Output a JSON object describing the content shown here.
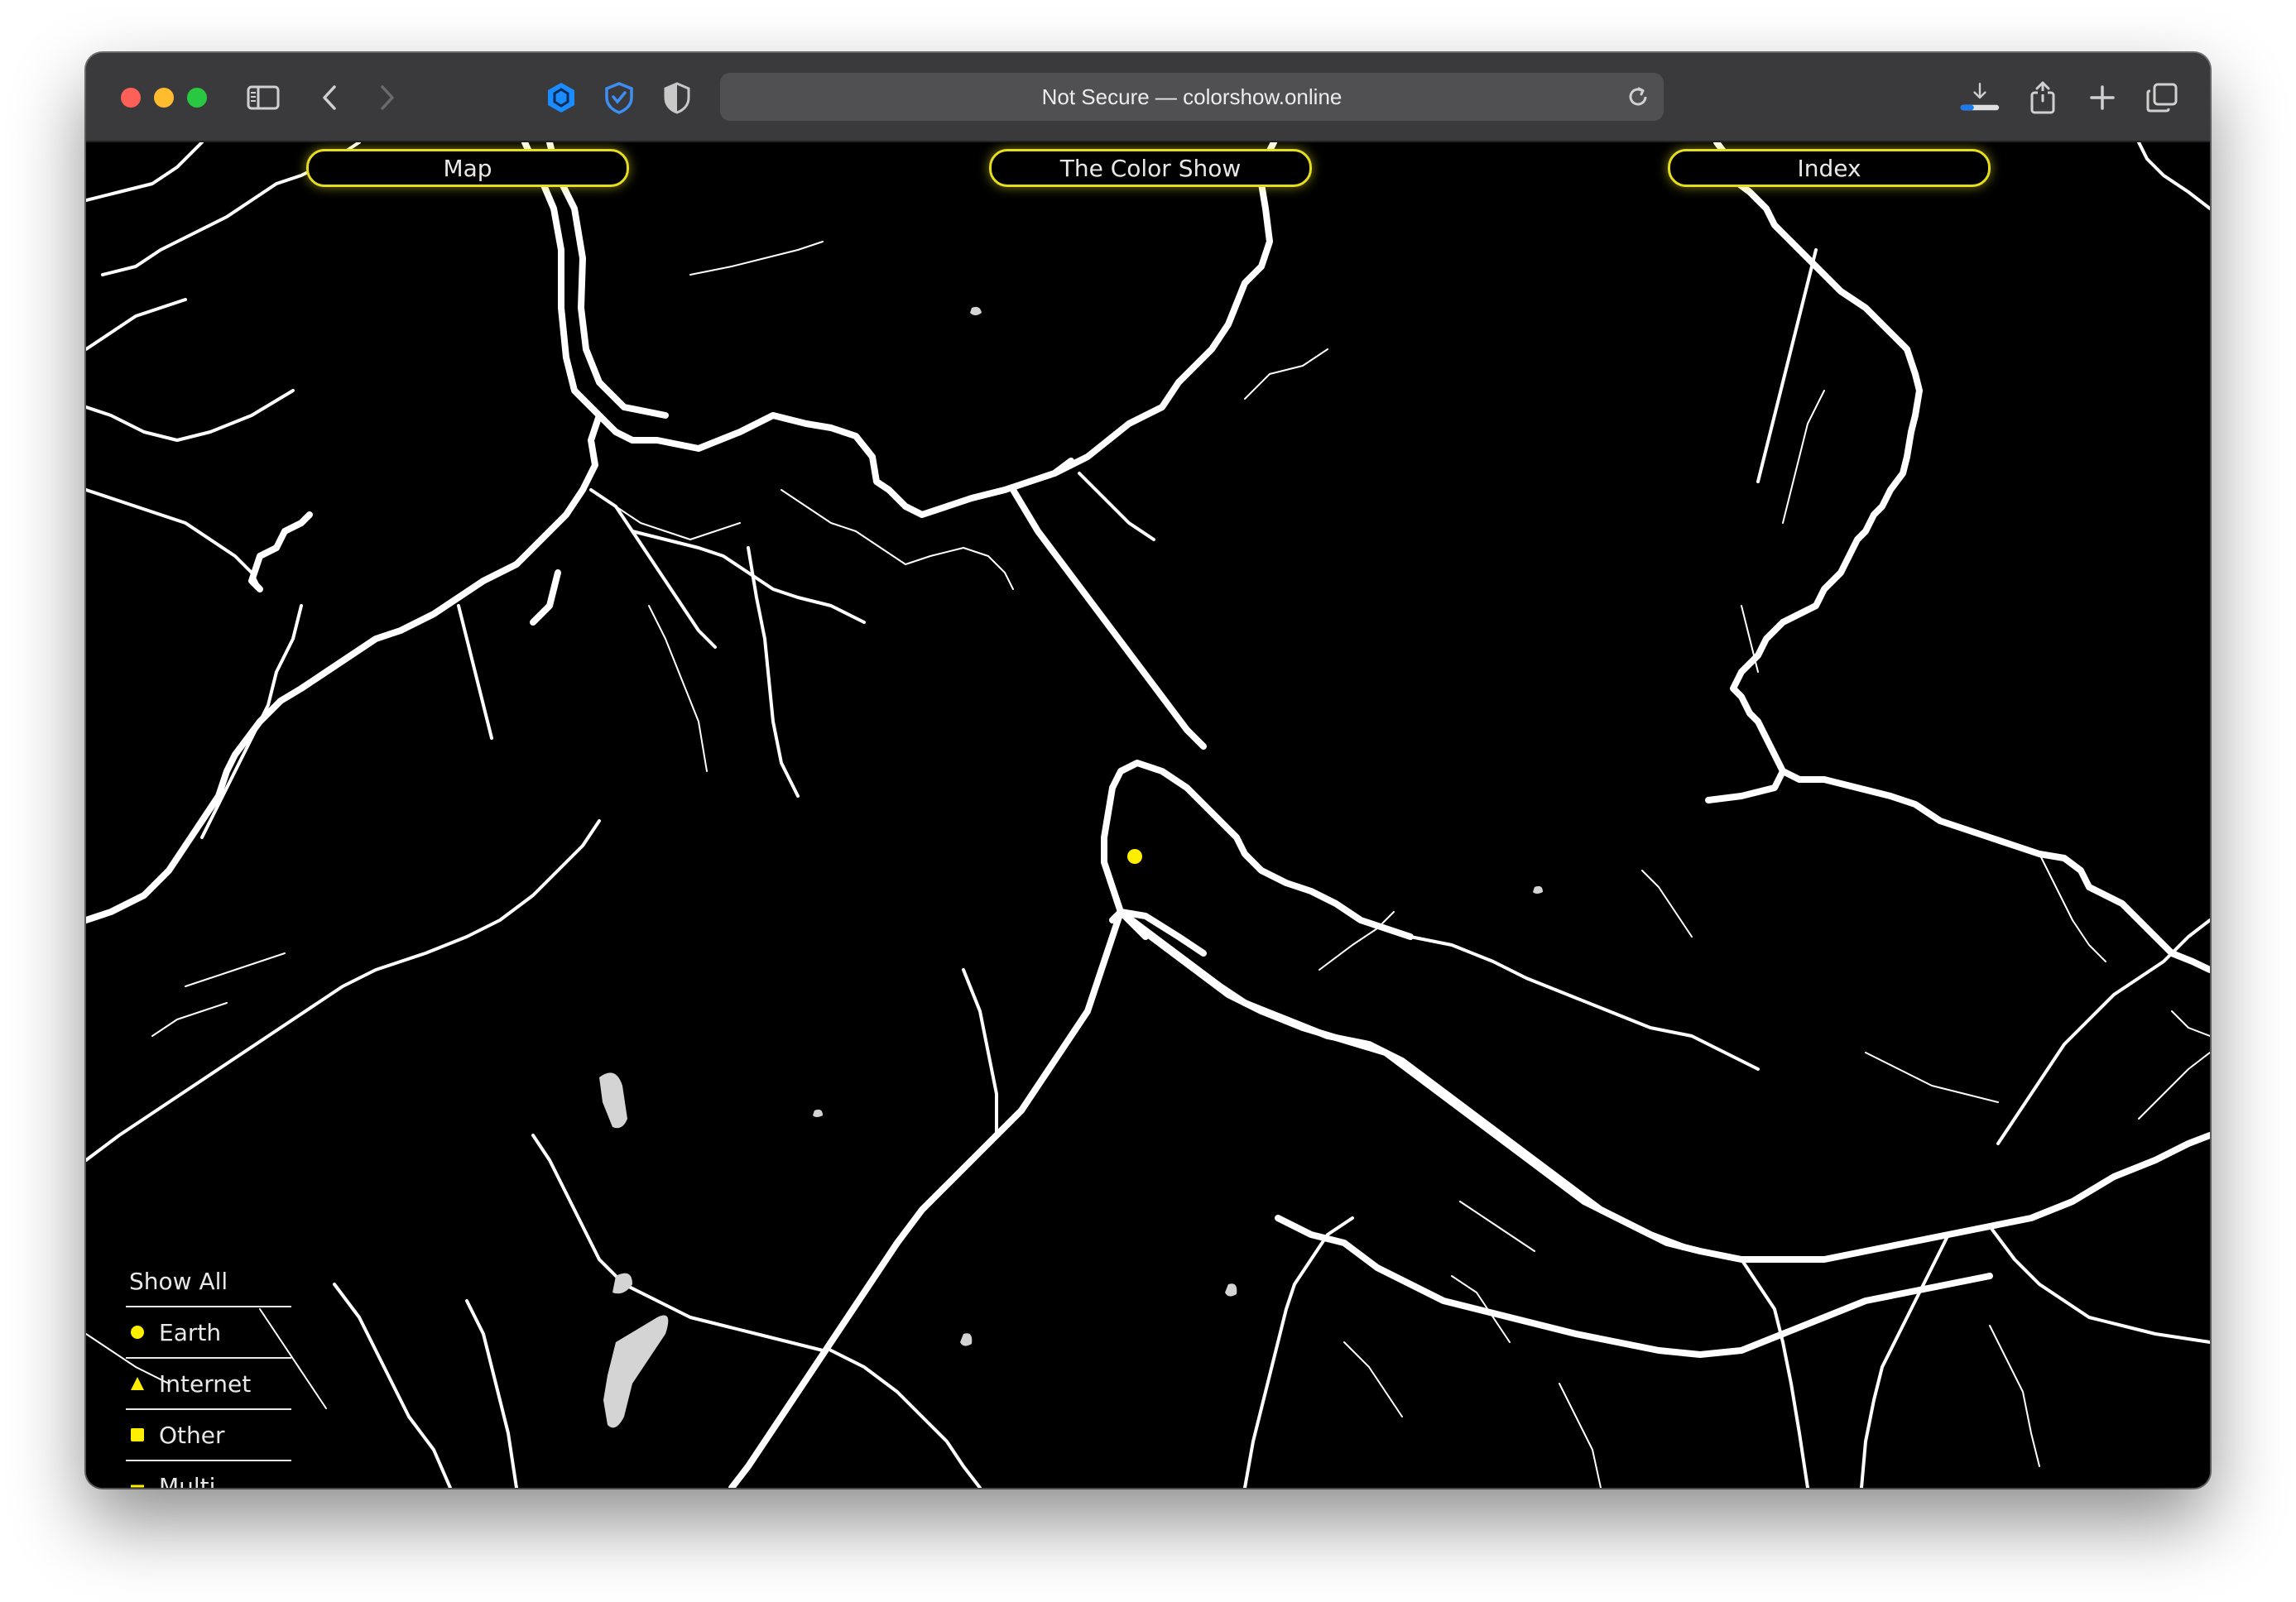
{
  "browser": {
    "url_text": "Not Secure — colorshow.online"
  },
  "nav": {
    "map": "Map",
    "color_show": "The Color Show",
    "index": "Index"
  },
  "legend": {
    "show_all": "Show All",
    "earth": "Earth",
    "internet": "Internet",
    "other": "Other",
    "multi": "Multi"
  },
  "colors": {
    "accent": "#e6dc20",
    "marker": "#ffee00",
    "map_lines": "#ffffff",
    "background": "#000000"
  }
}
